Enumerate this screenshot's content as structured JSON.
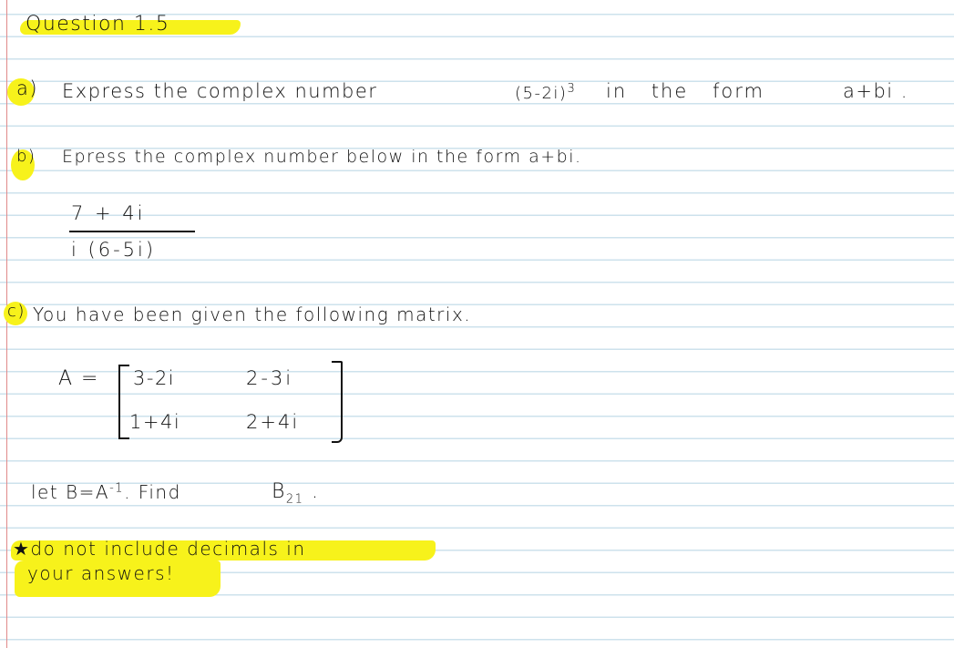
{
  "title": "Question 1.5",
  "part_a": {
    "label": "a)",
    "text_before": "Express the  complex number",
    "expression_base": "(5-2i)",
    "expression_exponent": "3",
    "text_after": "in   the   form",
    "form": "a+bi ."
  },
  "part_b": {
    "label": "b)",
    "text": "Epress the complex number  below in the  form  a+bi.",
    "numerator": "7 + 4i",
    "denominator": "i (6-5i)"
  },
  "part_c": {
    "label": "c)",
    "text": "You  have  been  given  the  following  matrix.",
    "matrix_name": "A  =",
    "matrix": [
      [
        "3-2i",
        "2-3i"
      ],
      [
        "1+4i",
        "2+4i"
      ]
    ],
    "instruction_before": "let  B=A",
    "instruction_exponent": "-1",
    "instruction_after": ". Find",
    "target": "B",
    "target_subscript": "21",
    "target_end": " ."
  },
  "note": {
    "line1": "★do not  include  decimals in",
    "line2": "your  answers!"
  },
  "colors": {
    "highlight": "#f7f21b",
    "rule_line": "#cde2ec",
    "margin_line": "#e08a8a",
    "ink": "#111111"
  }
}
